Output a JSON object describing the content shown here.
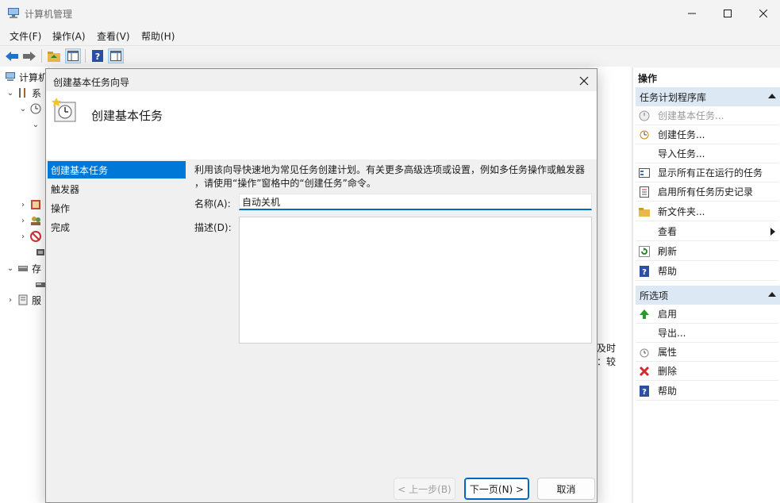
{
  "window": {
    "title": "计算机管理",
    "menu": [
      "文件(F)",
      "操作(A)",
      "查看(V)",
      "帮助(H)"
    ]
  },
  "tree": {
    "items": [
      "计算机",
      "系",
      "存",
      "服"
    ]
  },
  "middle_fragments": [
    "及时",
    "：较"
  ],
  "actions": {
    "header": "操作",
    "section1": {
      "title": "任务计划程序库",
      "items": [
        {
          "label": "创建基本任务...",
          "icon": "clock-star-icon",
          "disabled": true
        },
        {
          "label": "创建任务...",
          "icon": "clock-icon",
          "disabled": false
        },
        {
          "label": "导入任务...",
          "icon": "",
          "disabled": false
        },
        {
          "label": "显示所有正在运行的任务",
          "icon": "running-tasks-icon",
          "disabled": false
        },
        {
          "label": "启用所有任务历史记录",
          "icon": "history-icon",
          "disabled": false
        },
        {
          "label": "新文件夹...",
          "icon": "folder-icon",
          "disabled": false
        },
        {
          "label": "查看",
          "icon": "",
          "disabled": false
        },
        {
          "label": "刷新",
          "icon": "refresh-icon",
          "disabled": false
        },
        {
          "label": "帮助",
          "icon": "help-icon",
          "disabled": false
        }
      ]
    },
    "section2": {
      "title": "所选项",
      "items": [
        {
          "label": "启用",
          "icon": "up-arrow-icon"
        },
        {
          "label": "导出...",
          "icon": ""
        },
        {
          "label": "属性",
          "icon": "clock-icon"
        },
        {
          "label": "删除",
          "icon": "delete-icon"
        },
        {
          "label": "帮助",
          "icon": "help-icon"
        }
      ]
    }
  },
  "dialog": {
    "title": "创建基本任务向导",
    "heading": "创建基本任务",
    "steps": [
      "创建基本任务",
      "触发器",
      "操作",
      "完成"
    ],
    "intro_line1": "利用该向导快速地为常见任务创建计划。有关更多高级选项或设置，例如多任务操作或触发器",
    "intro_line2": "，请使用“操作”窗格中的“创建任务”命令。",
    "name_label": "名称(A):",
    "name_value": "自动关机",
    "desc_label": "描述(D):",
    "desc_value": "",
    "buttons": {
      "back": "< 上一步(B)",
      "next": "下一页(N) >",
      "cancel": "取消"
    }
  },
  "colors": {
    "accent": "#0078d7",
    "section_header_bg": "#dde8f5"
  }
}
